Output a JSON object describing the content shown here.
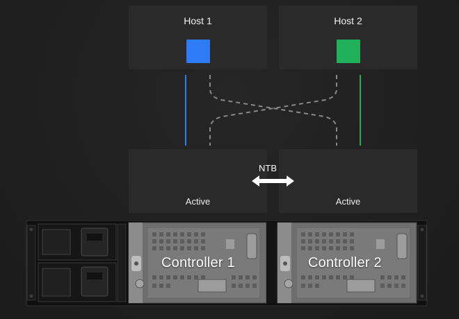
{
  "hosts": [
    {
      "title": "Host 1",
      "color": "#2f7bf6"
    },
    {
      "title": "Host 2",
      "color": "#21b05a"
    }
  ],
  "controllers": [
    {
      "state": "Active",
      "label": "Controller 1"
    },
    {
      "state": "Active",
      "label": "Controller 2"
    }
  ],
  "ntb": {
    "label": "NTB"
  },
  "colors": {
    "panel": "#2a2a2a",
    "background": "#1f1f1f",
    "dashed": "#8a8a8a"
  }
}
